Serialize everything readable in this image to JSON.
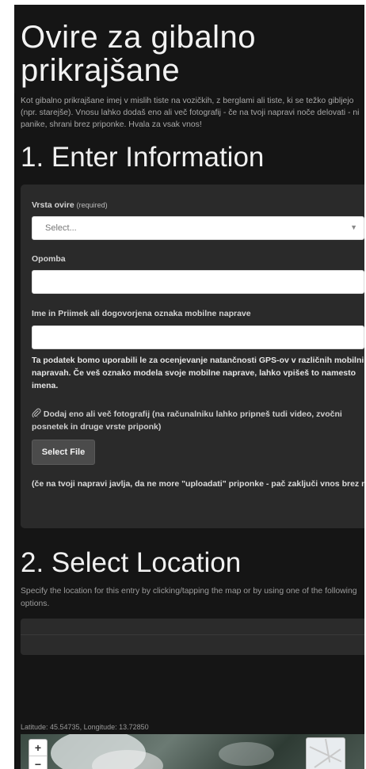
{
  "page": {
    "title": "Ovire za gibalno prikrajšane",
    "intro": "Kot gibalno prikrajšane imej v mislih tiste na vozičkih, z berglami ali tiste, ki se težko gibljejo (npr. starejše). Vnosu lahko dodaš eno ali več fotografij - če na tvoji napravi noče delovati - ni panike, shrani brez priponke. Hvala za vsak vnos!"
  },
  "section1": {
    "heading": "1. Enter Information",
    "vrsta_label": "Vrsta ovire",
    "required_tag": "(required)",
    "select_value": "Select...",
    "opomba_label": "Opomba",
    "opomba_value": "",
    "ime_label": "Ime in Priimek ali dogovorjena oznaka mobilne naprave",
    "ime_value": "",
    "gps_help": "Ta podatek bomo uporabili le za ocenjevanje natančnosti GPS-ov v različnih mobilnih napravah. Če veš oznako modela svoje mobilne naprave, lahko vpišeš to namesto imena.",
    "attach_label": "Dodaj eno ali več fotografij (na računalniku lahko pripneš tudi video, zvočni posnetek in druge vrste priponk)",
    "select_file_button": "Select File",
    "upload_note": "(če na tvoji napravi javlja, da ne more \"uploadati\" priponke - pač zaključi vnos brez nje)"
  },
  "section2": {
    "heading": "2. Select Location",
    "description": "Specify the location for this entry by clicking/tapping the map or by using one of the following options.",
    "coords": "Latitude: 45.54735, Longitude: 13.72850"
  },
  "map": {
    "zoom_in": "+",
    "zoom_out": "−"
  },
  "icons": {
    "paperclip": "paperclip-icon",
    "dropdown": "chevron-down-icon"
  },
  "colors": {
    "page_bg": "#151515",
    "card_bg": "#2a2a2a",
    "button_bg": "#4b4b4b"
  }
}
